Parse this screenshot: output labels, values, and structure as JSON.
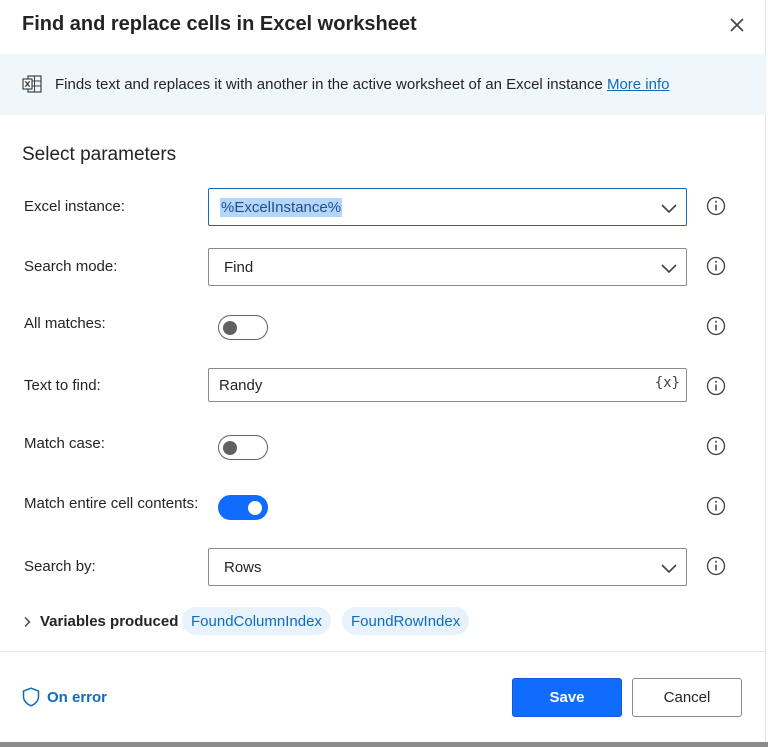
{
  "dialog": {
    "title": "Find and replace cells in Excel worksheet",
    "close_icon": "close-icon"
  },
  "info": {
    "icon": "excel-icon",
    "description": "Finds text and replaces it with another in the active worksheet of an Excel instance",
    "more_info_link": "More info"
  },
  "section_title": "Select parameters",
  "params": {
    "excel_instance": {
      "label": "Excel instance:",
      "value": "%ExcelInstance%"
    },
    "search_mode": {
      "label": "Search mode:",
      "value": "Find"
    },
    "all_matches": {
      "label": "All matches:",
      "on": false
    },
    "text_to_find": {
      "label": "Text to find:",
      "value": "Randy",
      "var_button": "{x}"
    },
    "match_case": {
      "label": "Match case:",
      "on": false
    },
    "match_entire": {
      "label": "Match entire cell contents:",
      "on": true
    },
    "search_by": {
      "label": "Search by:",
      "value": "Rows"
    }
  },
  "variables": {
    "label": "Variables produced",
    "chips": [
      "FoundColumnIndex",
      "FoundRowIndex"
    ]
  },
  "footer": {
    "on_error": "On error",
    "save": "Save",
    "cancel": "Cancel"
  },
  "colors": {
    "accent": "#0f6cfd",
    "link": "#0f6cbd",
    "info_bar_bg": "#eff6fc",
    "chip_bg": "#e8f2fb"
  }
}
